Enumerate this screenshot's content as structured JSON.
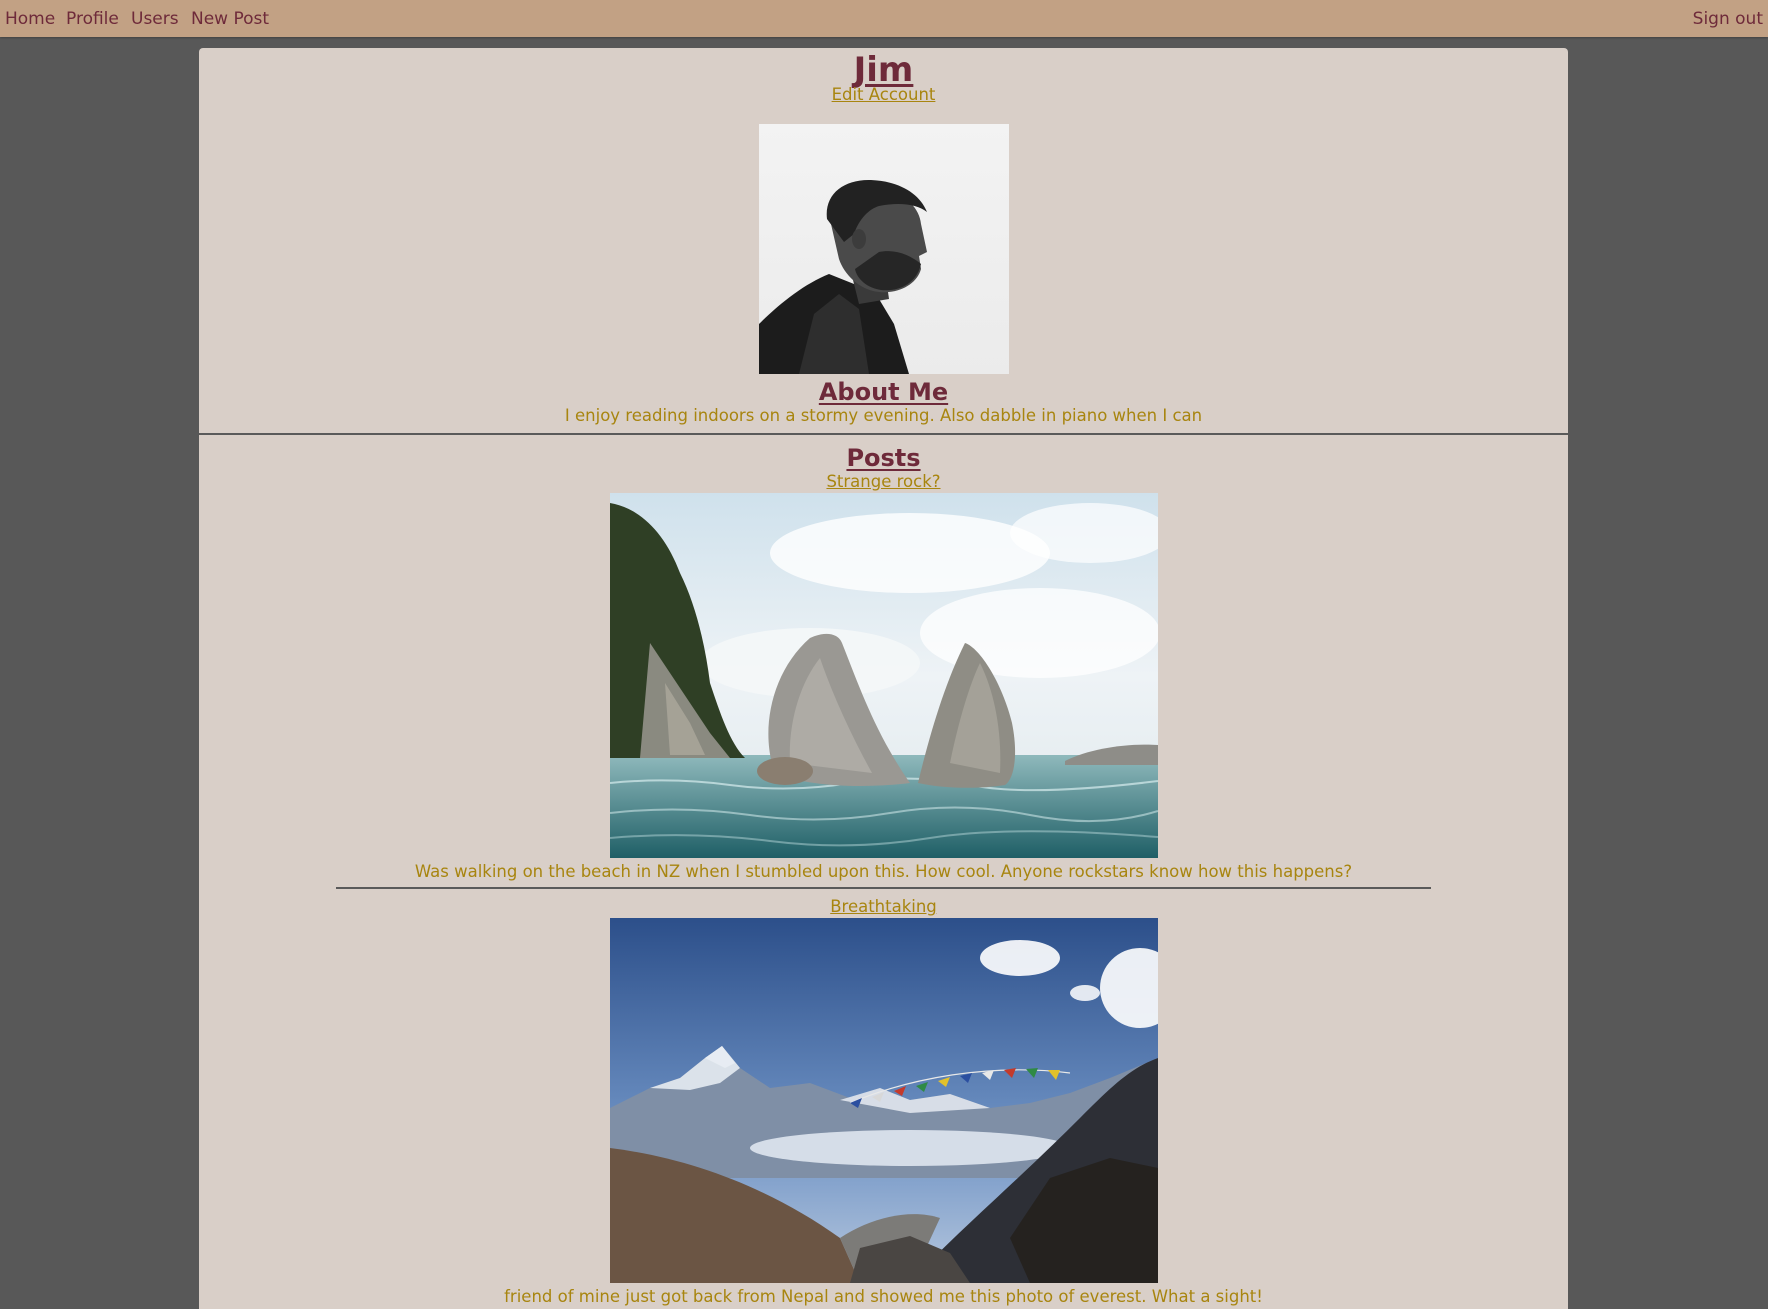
{
  "nav": {
    "home": "Home",
    "profile": "Profile",
    "users": "Users",
    "new_post": "New Post",
    "sign_out": "Sign out"
  },
  "profile": {
    "name": "Jim",
    "edit_account": "Edit Account",
    "about_title": "About Me",
    "about_text": "I enjoy reading indoors on a stormy evening. Also dabble in piano when I can"
  },
  "posts": {
    "title": "Posts",
    "items": [
      {
        "title": "Strange rock?",
        "caption": "Was walking on the beach in NZ when I stumbled upon this. How cool. Anyone rockstars know how this happens?"
      },
      {
        "title": "Breathtaking",
        "caption": "friend of mine just got back from Nepal and showed me this photo of everest. What a sight!"
      }
    ]
  },
  "colors": {
    "navbar": "#c2a184",
    "page_bg": "#585858",
    "panel_bg": "#d9cfc8",
    "heading": "#6e2a3a",
    "link_text": "#a8850f"
  }
}
